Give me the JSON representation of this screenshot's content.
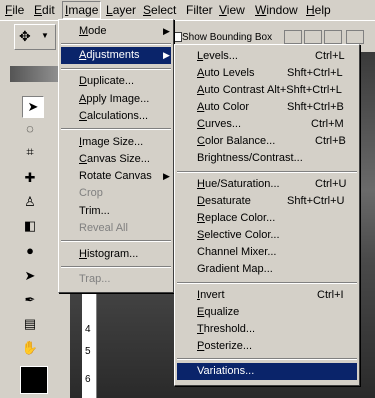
{
  "menubar": {
    "items": [
      "File",
      "Edit",
      "Image",
      "Layer",
      "Select",
      "Filter",
      "View",
      "Window",
      "Help"
    ]
  },
  "optionsbar": {
    "show_bounding_box": "Show Bounding Box"
  },
  "image_menu": {
    "items": [
      {
        "label": "Mode",
        "shortcut": "",
        "submenu": true
      },
      {
        "label": "Adjustments",
        "shortcut": "",
        "submenu": true,
        "highlighted": true
      },
      {
        "label": "Duplicate...",
        "shortcut": ""
      },
      {
        "label": "Apply Image...",
        "shortcut": ""
      },
      {
        "label": "Calculations...",
        "shortcut": ""
      },
      {
        "label": "Image Size...",
        "shortcut": ""
      },
      {
        "label": "Canvas Size...",
        "shortcut": ""
      },
      {
        "label": "Rotate Canvas",
        "shortcut": "",
        "submenu": true
      },
      {
        "label": "Crop",
        "shortcut": "",
        "disabled": true
      },
      {
        "label": "Trim...",
        "shortcut": ""
      },
      {
        "label": "Reveal All",
        "shortcut": "",
        "disabled": true
      },
      {
        "label": "Histogram...",
        "shortcut": ""
      },
      {
        "label": "Trap...",
        "shortcut": "",
        "disabled": true
      }
    ]
  },
  "adjust_menu": {
    "items": [
      {
        "label": "Levels...",
        "shortcut": "Ctrl+L"
      },
      {
        "label": "Auto Levels",
        "shortcut": "Shft+Ctrl+L"
      },
      {
        "label": "Auto Contrast",
        "shortcut": "Alt+Shft+Ctrl+L"
      },
      {
        "label": "Auto Color",
        "shortcut": "Shft+Ctrl+B"
      },
      {
        "label": "Curves...",
        "shortcut": "Ctrl+M"
      },
      {
        "label": "Color Balance...",
        "shortcut": "Ctrl+B"
      },
      {
        "label": "Brightness/Contrast...",
        "shortcut": ""
      },
      {
        "label": "Hue/Saturation...",
        "shortcut": "Ctrl+U"
      },
      {
        "label": "Desaturate",
        "shortcut": "Shft+Ctrl+U"
      },
      {
        "label": "Replace Color...",
        "shortcut": ""
      },
      {
        "label": "Selective Color...",
        "shortcut": ""
      },
      {
        "label": "Channel Mixer...",
        "shortcut": ""
      },
      {
        "label": "Gradient Map...",
        "shortcut": ""
      },
      {
        "label": "Invert",
        "shortcut": "Ctrl+I"
      },
      {
        "label": "Equalize",
        "shortcut": ""
      },
      {
        "label": "Threshold...",
        "shortcut": ""
      },
      {
        "label": "Posterize...",
        "shortcut": ""
      },
      {
        "label": "Variations...",
        "shortcut": "",
        "highlighted": true
      }
    ]
  },
  "ruler": {
    "numbers": [
      "4",
      "5",
      "6"
    ]
  },
  "colors": {
    "highlight": "#0a246a",
    "chrome": "#d4d0c8"
  }
}
